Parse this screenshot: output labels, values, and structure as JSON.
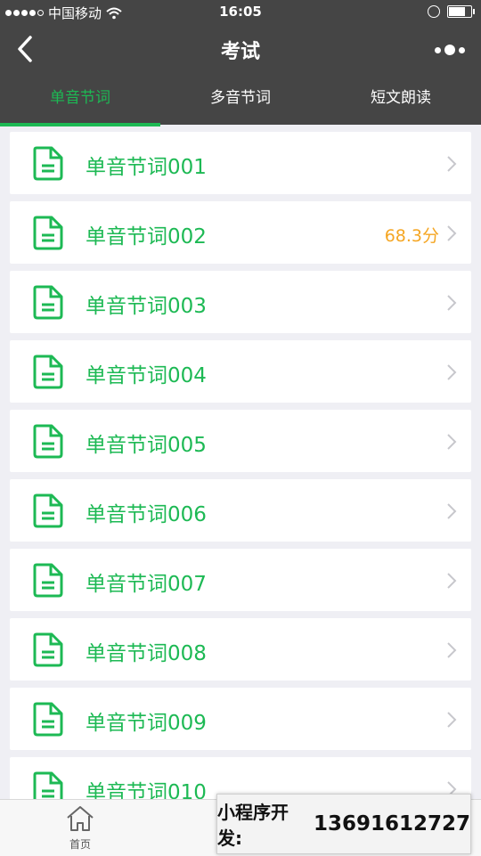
{
  "status_bar": {
    "carrier": "中国移动",
    "time": "16:05"
  },
  "nav": {
    "title": "考试"
  },
  "tabs": [
    {
      "label": "单音节词",
      "active": true
    },
    {
      "label": "多音节词",
      "active": false
    },
    {
      "label": "短文朗读",
      "active": false
    }
  ],
  "items": [
    {
      "title": "单音节词001",
      "score": ""
    },
    {
      "title": "单音节词002",
      "score": "68.3分"
    },
    {
      "title": "单音节词003",
      "score": ""
    },
    {
      "title": "单音节词004",
      "score": ""
    },
    {
      "title": "单音节词005",
      "score": ""
    },
    {
      "title": "单音节词006",
      "score": ""
    },
    {
      "title": "单音节词007",
      "score": ""
    },
    {
      "title": "单音节词008",
      "score": ""
    },
    {
      "title": "单音节词009",
      "score": ""
    },
    {
      "title": "单音节词010",
      "score": ""
    }
  ],
  "tabbar": {
    "home_label": "首页"
  },
  "overlay": {
    "label": "小程序开发:",
    "phone": "13691612727"
  },
  "colors": {
    "accent": "#1db954",
    "score": "#f5a623",
    "header_bg": "#454545"
  }
}
